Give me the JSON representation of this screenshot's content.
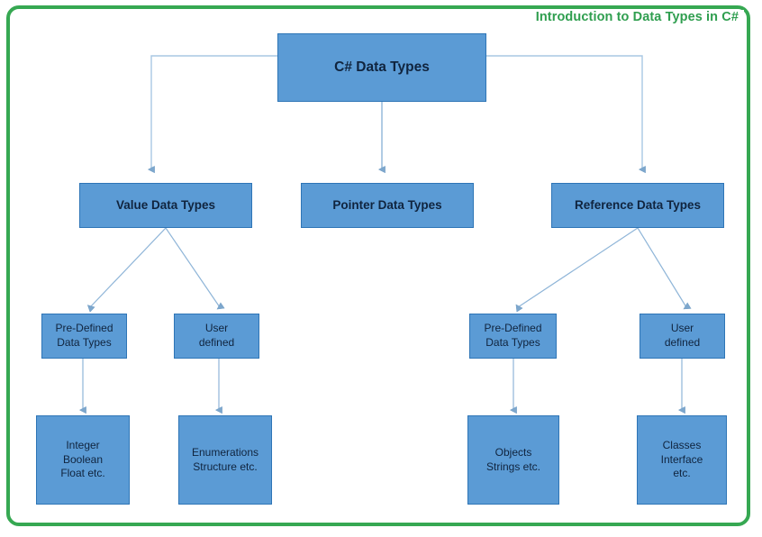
{
  "page": {
    "title": "Introduction to Data Types in C#",
    "frame_color": "#36a852",
    "title_color": "#2f9e4f",
    "node_fill": "#5b9bd5",
    "node_border": "#2e75b6",
    "connector_color": "#7da7cd",
    "background": "#ffffff"
  },
  "chart_data": {
    "type": "diagram",
    "title": "Introduction to Data Types in C#",
    "nodes": [
      {
        "id": "root",
        "label": "C# Data Types",
        "level": 1
      },
      {
        "id": "value",
        "label": "Value Data Types",
        "level": 2
      },
      {
        "id": "pointer",
        "label": "Pointer Data Types",
        "level": 2
      },
      {
        "id": "reference",
        "label": "Reference Data Types",
        "level": 2
      },
      {
        "id": "value_pre",
        "label": "Pre-Defined\nData Types",
        "level": 3
      },
      {
        "id": "value_user",
        "label": "User\ndefined",
        "level": 3
      },
      {
        "id": "ref_pre",
        "label": "Pre-Defined\nData Types",
        "level": 3
      },
      {
        "id": "ref_user",
        "label": "User\ndefined",
        "level": 3
      },
      {
        "id": "value_pre_ex",
        "label": "Integer\nBoolean\nFloat etc.",
        "level": 4
      },
      {
        "id": "value_user_ex",
        "label": "Enumerations\nStructure etc.",
        "level": 4
      },
      {
        "id": "ref_pre_ex",
        "label": "Objects\nStrings etc.",
        "level": 4
      },
      {
        "id": "ref_user_ex",
        "label": "Classes\nInterface\netc.",
        "level": 4
      }
    ],
    "edges": [
      {
        "from": "root",
        "to": "value"
      },
      {
        "from": "root",
        "to": "pointer"
      },
      {
        "from": "root",
        "to": "reference"
      },
      {
        "from": "value",
        "to": "value_pre"
      },
      {
        "from": "value",
        "to": "value_user"
      },
      {
        "from": "reference",
        "to": "ref_pre"
      },
      {
        "from": "reference",
        "to": "ref_user"
      },
      {
        "from": "value_pre",
        "to": "value_pre_ex"
      },
      {
        "from": "value_user",
        "to": "value_user_ex"
      },
      {
        "from": "ref_pre",
        "to": "ref_pre_ex"
      },
      {
        "from": "ref_user",
        "to": "ref_user_ex"
      }
    ]
  },
  "nodes": {
    "root": {
      "label": "C# Data Types"
    },
    "value": {
      "label": "Value Data Types"
    },
    "pointer": {
      "label": "Pointer Data Types"
    },
    "reference": {
      "label": "Reference Data Types"
    },
    "value_pre": {
      "label": "Pre-Defined\nData Types"
    },
    "value_user": {
      "label": "User\ndefined"
    },
    "ref_pre": {
      "label": "Pre-Defined\nData Types"
    },
    "ref_user": {
      "label": "User\ndefined"
    },
    "value_pre_ex": {
      "label": "Integer\nBoolean\nFloat etc."
    },
    "value_user_ex": {
      "label": "Enumerations\nStructure etc."
    },
    "ref_pre_ex": {
      "label": "Objects\nStrings etc."
    },
    "ref_user_ex": {
      "label": "Classes\nInterface\netc."
    }
  }
}
